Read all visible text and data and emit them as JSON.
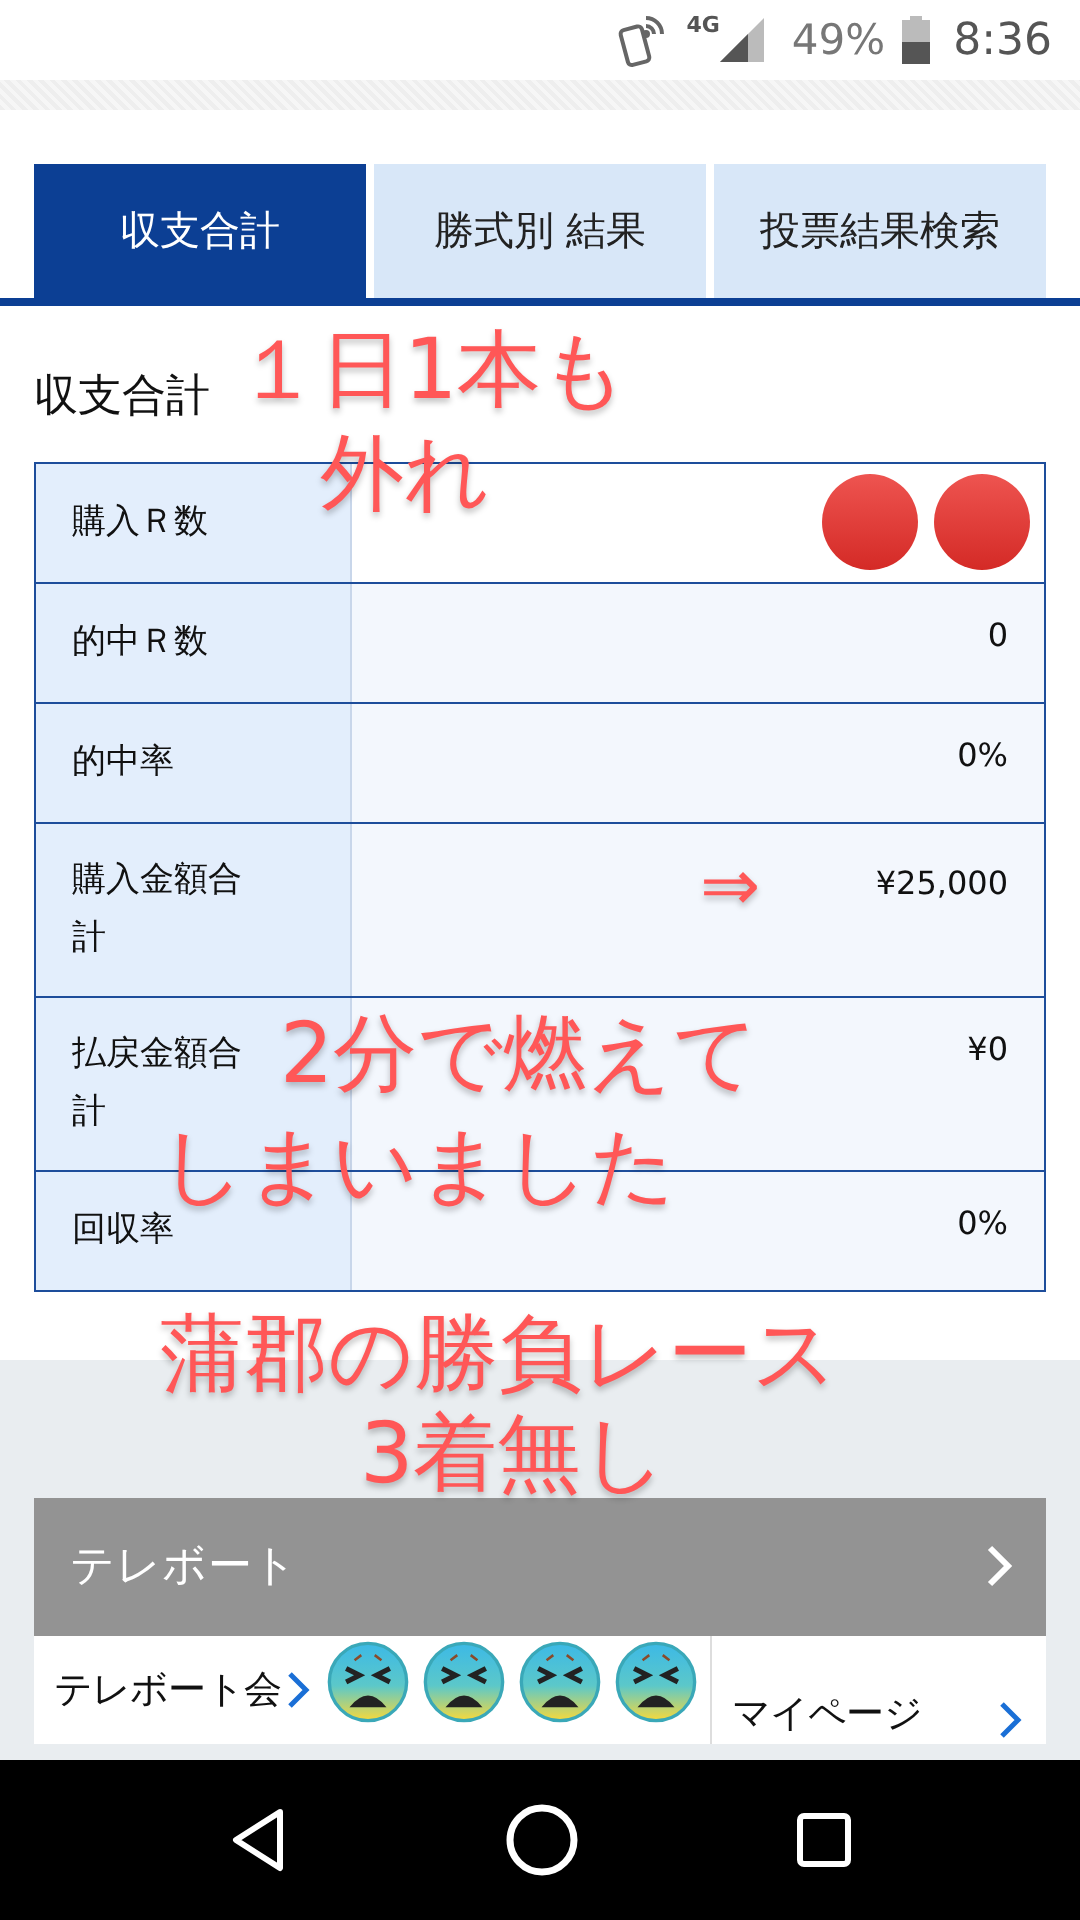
{
  "status_bar": {
    "network": "4G",
    "battery": "49%",
    "time": "8:36"
  },
  "tabs": [
    {
      "label": "収支合計",
      "selected": true
    },
    {
      "label": "勝式別 結果",
      "selected": false
    },
    {
      "label": "投票結果検索",
      "selected": false
    }
  ],
  "heading": "収支合計",
  "table": {
    "rows": [
      {
        "label": "購入Ｒ数"
      },
      {
        "label": "的中Ｒ数",
        "value": "0"
      },
      {
        "label": "的中率",
        "value": "0%"
      },
      {
        "label": "購入金額合計",
        "value": "¥25,000"
      },
      {
        "label": "払戻金額合計",
        "value": "¥0"
      },
      {
        "label": "回収率",
        "value": "0%"
      }
    ]
  },
  "teleboat": {
    "title": "テレボート",
    "items": [
      {
        "label": "テレボート会"
      },
      {
        "label": "マイページ"
      }
    ]
  },
  "annotations": [
    "１日1本も",
    "外れ",
    "2分で燃えて",
    "しまいました",
    "蒲郡の勝負レース",
    "3着無し"
  ],
  "arrow": "⇒"
}
